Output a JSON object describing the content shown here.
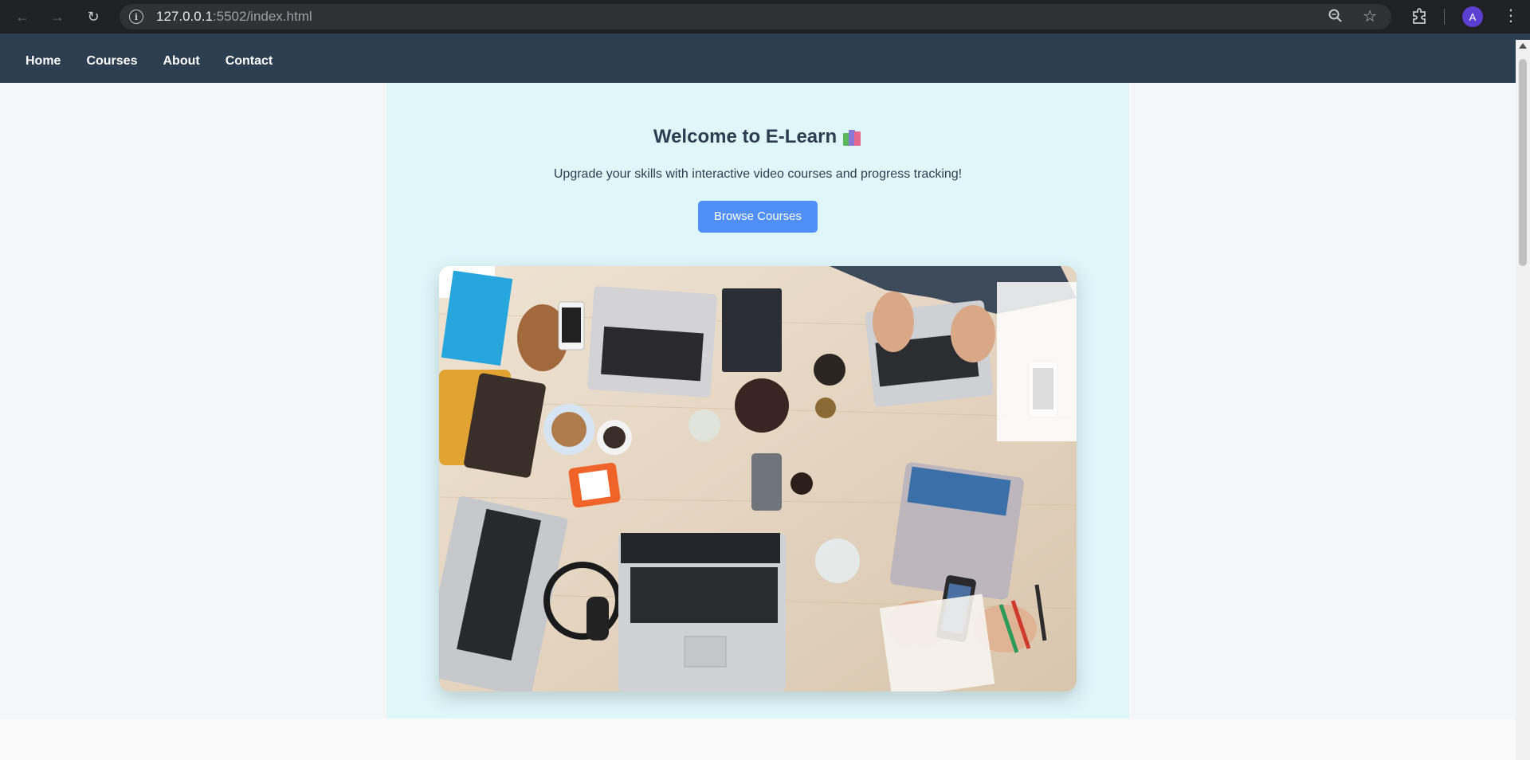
{
  "browser": {
    "url_host": "127.0.0.1",
    "url_rest": ":5502/index.html",
    "avatar_letter": "A"
  },
  "nav": {
    "items": [
      "Home",
      "Courses",
      "About",
      "Contact"
    ]
  },
  "hero": {
    "title": "Welcome to E-Learn",
    "subtitle": "Upgrade your skills with interactive video courses and progress tracking!",
    "button": "Browse Courses",
    "image_subject": "overhead photo of a shared desk with laptops, phones and coffee"
  },
  "colors": {
    "nav_bg": "#2c3e50",
    "hero_bg": "#e0f7fa",
    "button_bg": "#4f8ff7",
    "page_bg": "#f4f6f8"
  }
}
